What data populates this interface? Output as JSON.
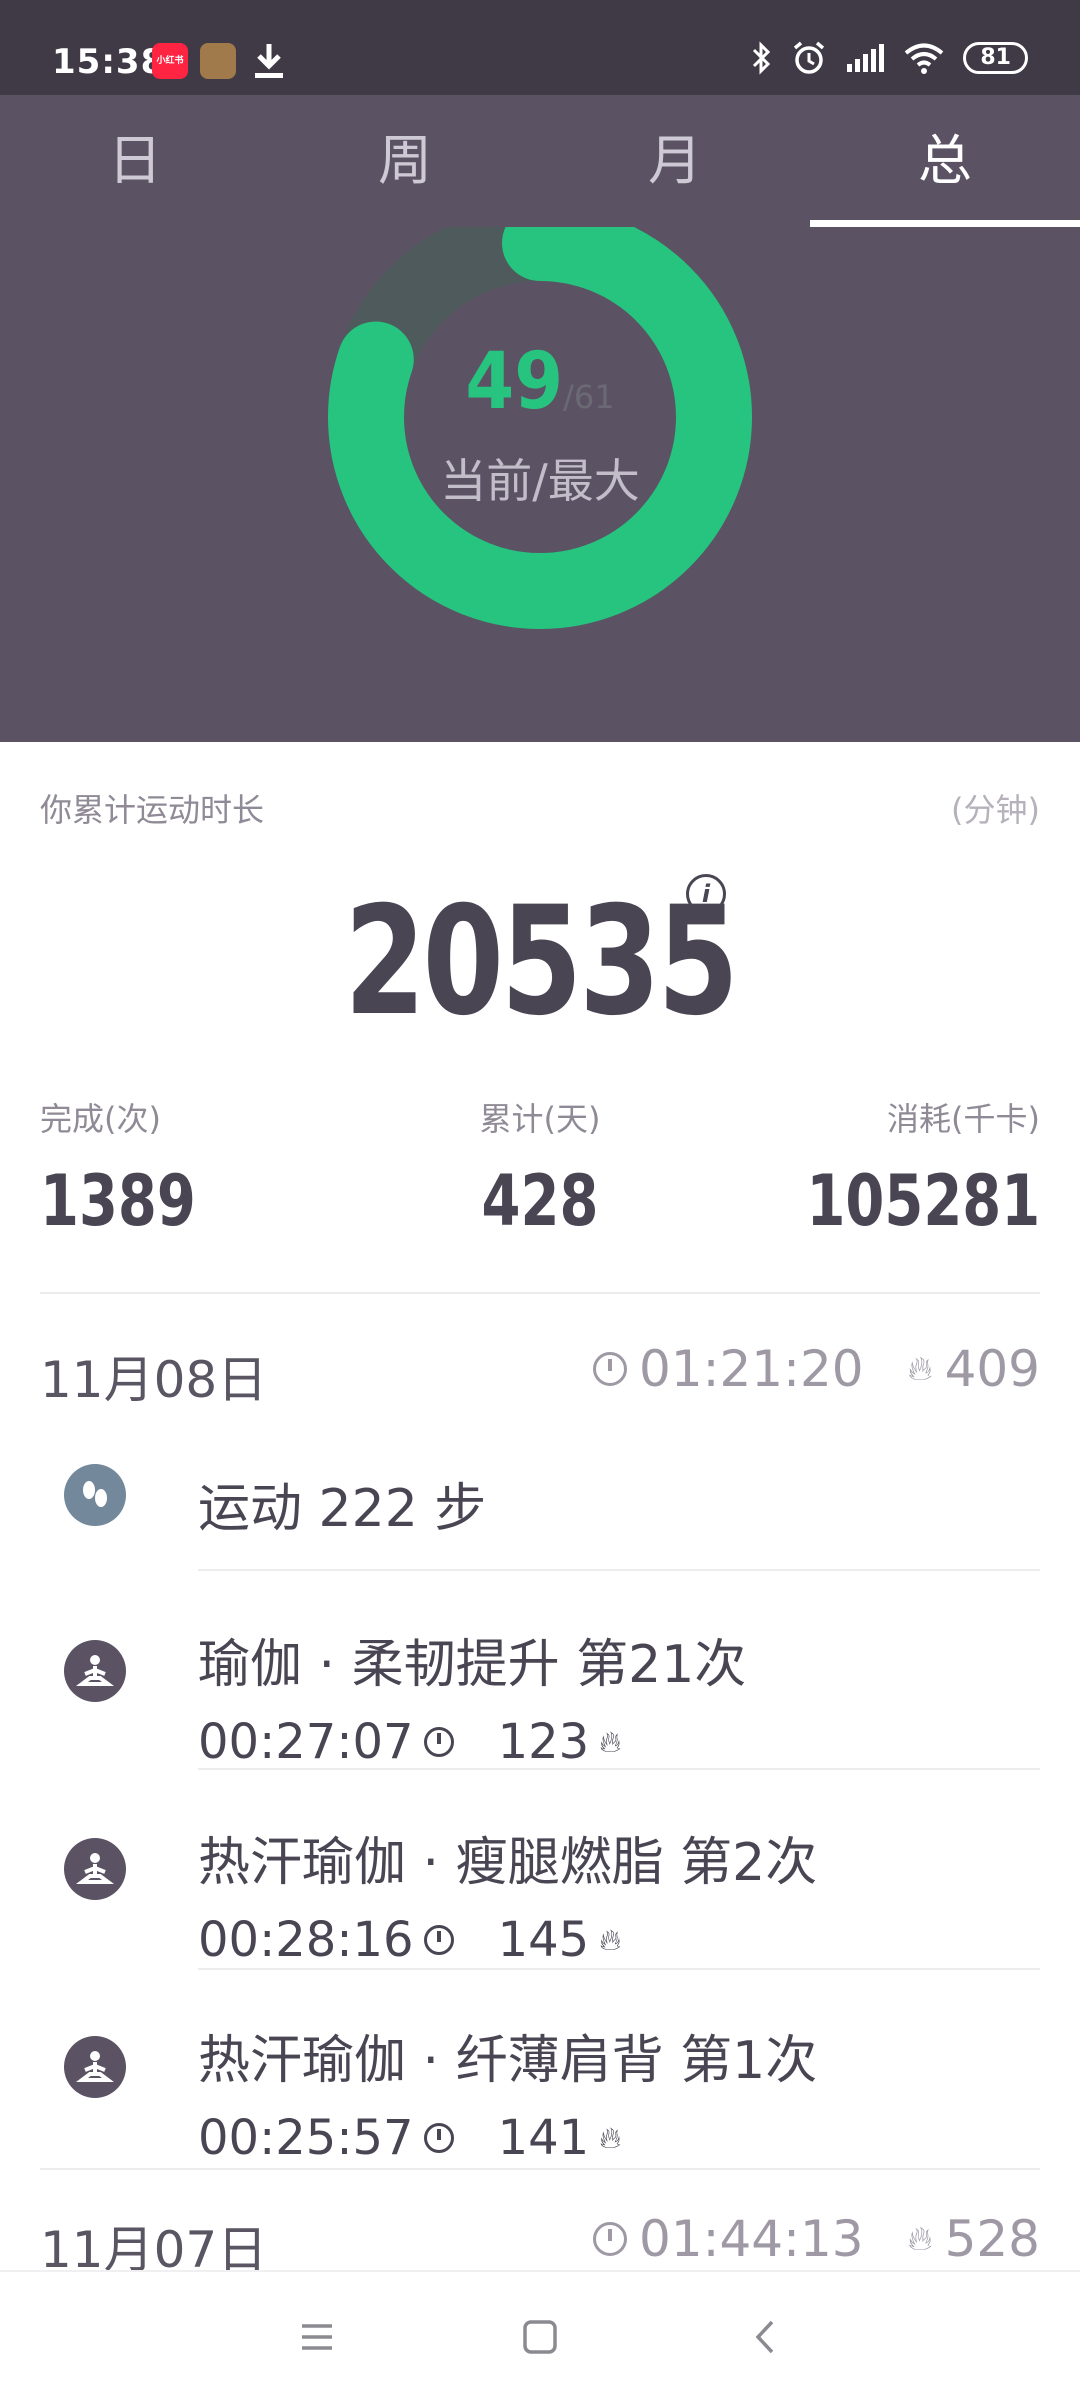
{
  "status": {
    "time": "15:38",
    "app1": "小红书",
    "battery": "81"
  },
  "tabs": [
    {
      "label": "日"
    },
    {
      "label": "周"
    },
    {
      "label": "月"
    },
    {
      "label": "总",
      "active": true
    }
  ],
  "ring": {
    "current": "49",
    "max": "/61",
    "label": "当前/最大",
    "progress_fraction": 0.8033,
    "colors": {
      "fill": "#27c480",
      "track": "#4e5a5b"
    }
  },
  "summary": {
    "title": "你累计运动时长",
    "unit": "(分钟)",
    "total": "20535",
    "info_icon": "info-icon",
    "stats": [
      {
        "label": "完成(次)",
        "value": "1389"
      },
      {
        "label": "累计(天)",
        "value": "428"
      },
      {
        "label": "消耗(千卡)",
        "value": "105281"
      }
    ]
  },
  "days": [
    {
      "date": "11月08日",
      "duration": "01:21:20",
      "calories": "409",
      "activities": [
        {
          "type": "steps",
          "icon": "footprints-icon",
          "title": "运动 222 步"
        },
        {
          "type": "yoga",
          "icon": "yoga-icon",
          "title": "瑜伽 · 柔韧提升 第21次",
          "duration": "00:27:07",
          "calories": "123"
        },
        {
          "type": "yoga",
          "icon": "yoga-icon",
          "title": "热汗瑜伽 · 瘦腿燃脂 第2次",
          "duration": "00:28:16",
          "calories": "145"
        },
        {
          "type": "yoga",
          "icon": "yoga-icon",
          "title": "热汗瑜伽 · 纤薄肩背 第1次",
          "duration": "00:25:57",
          "calories": "141"
        }
      ]
    },
    {
      "date": "11月07日",
      "duration": "01:44:13",
      "calories": "528"
    }
  ],
  "icons": {
    "bluetooth": "bluetooth-icon",
    "alarm": "alarm-icon",
    "signal": "signal-icon",
    "wifi": "wifi-icon",
    "download": "download-icon",
    "nav_menu": "menu-icon",
    "nav_home": "home-square-icon",
    "nav_back": "back-chevron-icon"
  }
}
